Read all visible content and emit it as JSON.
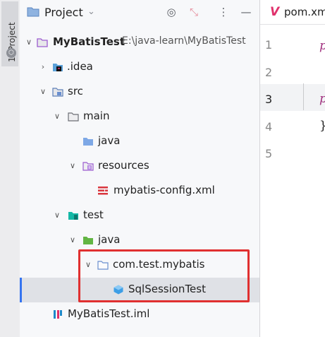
{
  "side_tab": {
    "label": "1: Project"
  },
  "toolbar": {
    "title": "Project"
  },
  "tree": {
    "root": {
      "name": "MyBatisTest",
      "path": "E:\\java-learn\\MyBatisTest"
    },
    "idea": ".idea",
    "src": "src",
    "main": "main",
    "main_java": "java",
    "resources": "resources",
    "config": "mybatis-config.xml",
    "test": "test",
    "test_java": "java",
    "package": "com.test.mybatis",
    "test_class": "SqlSessionTest",
    "iml": "MyBatisTest.iml"
  },
  "editor": {
    "tab": "pom.xml",
    "line_numbers": [
      "1",
      "2",
      "3",
      "4",
      "5"
    ],
    "code_chars": [
      "p",
      "p",
      "}"
    ]
  },
  "colors": {
    "highlight": "#e03030",
    "selection_bar": "#3574f0",
    "editor_tab_icon": "#e0306b"
  }
}
